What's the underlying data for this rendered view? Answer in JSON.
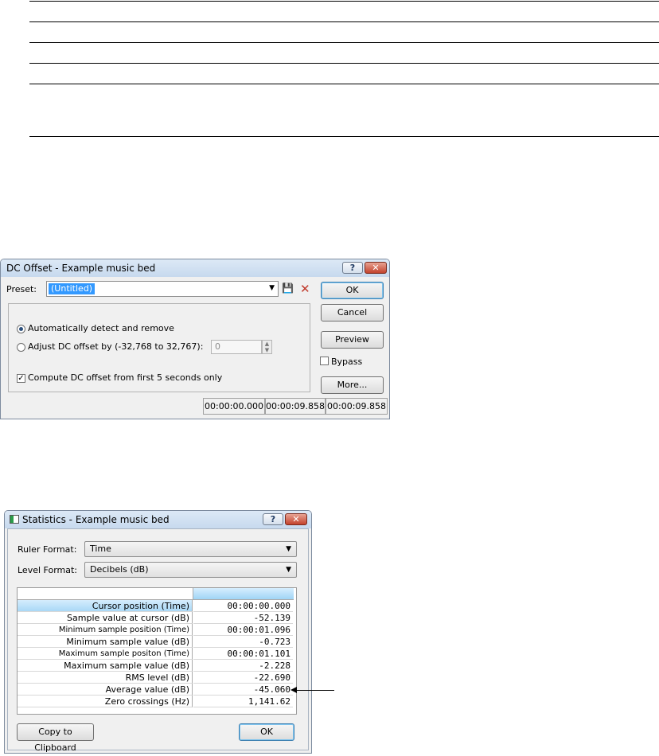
{
  "dc_offset": {
    "title": "DC Offset - Example music bed",
    "preset_label": "Preset:",
    "preset_value": "(Untitled)",
    "ok_label": "OK",
    "cancel_label": "Cancel",
    "preview_label": "Preview",
    "bypass_label": "Bypass",
    "more_label": "More...",
    "option_auto_label": "Automatically detect and remove",
    "option_adjust_label": "Adjust DC offset by (-32,768 to 32,767):",
    "adjust_value": "0",
    "compute_label": "Compute DC offset from first 5 seconds only",
    "status": [
      "00:00:00.000",
      "00:00:09.858",
      "00:00:09.858"
    ]
  },
  "statistics": {
    "title": "Statistics - Example music bed",
    "ruler_format_label": "Ruler Format:",
    "ruler_format_value": "Time",
    "level_format_label": "Level Format:",
    "level_format_value": "Decibels (dB)",
    "rows": [
      {
        "name": "Cursor position (Time)",
        "value": "00:00:00.000"
      },
      {
        "name": "Sample value at cursor (dB)",
        "value": "-52.139"
      },
      {
        "name": "Minimum sample position (Time)",
        "value": "00:00:01.096"
      },
      {
        "name": "Minimum sample value (dB)",
        "value": "-0.723"
      },
      {
        "name": "Maximum sample positon (Time)",
        "value": "00:00:01.101"
      },
      {
        "name": "Maximum sample value (dB)",
        "value": "-2.228"
      },
      {
        "name": "RMS level (dB)",
        "value": "-22.690"
      },
      {
        "name": "Average value (dB)",
        "value": "-45.060"
      },
      {
        "name": "Zero crossings (Hz)",
        "value": "1,141.62"
      }
    ],
    "copy_label": "Copy to Clipboard",
    "ok_label": "OK"
  },
  "icons": {
    "help": "?",
    "close": "✕",
    "dropdown": "▼",
    "spin_up": "▲",
    "spin_down": "▼",
    "save": "💾",
    "delete": "✕",
    "check": "✓"
  },
  "colors": {
    "selection": "#3399ff",
    "delete_icon": "#c0392b"
  }
}
